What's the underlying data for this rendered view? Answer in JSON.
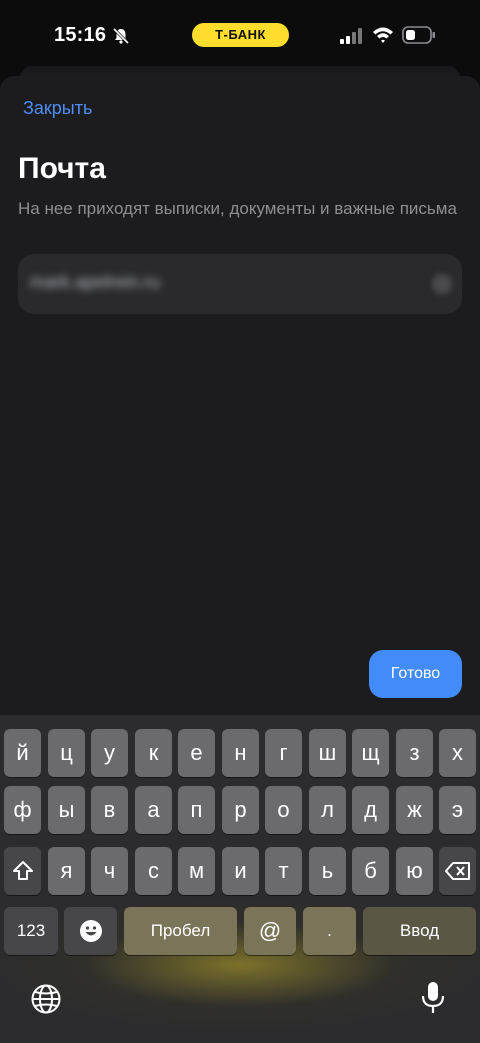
{
  "status_bar": {
    "time": "15:16",
    "carrier_badge": "Т-БАНК",
    "icons": [
      "bell-muted-icon",
      "signal-icon",
      "wifi-icon",
      "battery-icon"
    ]
  },
  "sheet": {
    "close_label": "Закрыть",
    "title": "Почта",
    "subtitle": "На нее приходят выписки, документы и важные письма",
    "email_value": "mark.apelrein.ru",
    "done_label": "Готово"
  },
  "keyboard": {
    "row1": [
      "й",
      "ц",
      "у",
      "к",
      "е",
      "н",
      "г",
      "ш",
      "щ",
      "з",
      "х"
    ],
    "row2": [
      "ф",
      "ы",
      "в",
      "а",
      "п",
      "р",
      "о",
      "л",
      "д",
      "ж",
      "э"
    ],
    "row3": [
      "я",
      "ч",
      "с",
      "м",
      "и",
      "т",
      "ь",
      "б",
      "ю"
    ],
    "numbers_label": "123",
    "space_label": "Пробел",
    "at_label": "@",
    "dot_label": ".",
    "return_label": "Ввод"
  },
  "colors": {
    "accent": "#428bf9",
    "link": "#4c8df6",
    "brand_yellow": "#ffdd2d",
    "sheet_bg": "#1c1c1e",
    "key_bg": "#6b6b6e"
  }
}
